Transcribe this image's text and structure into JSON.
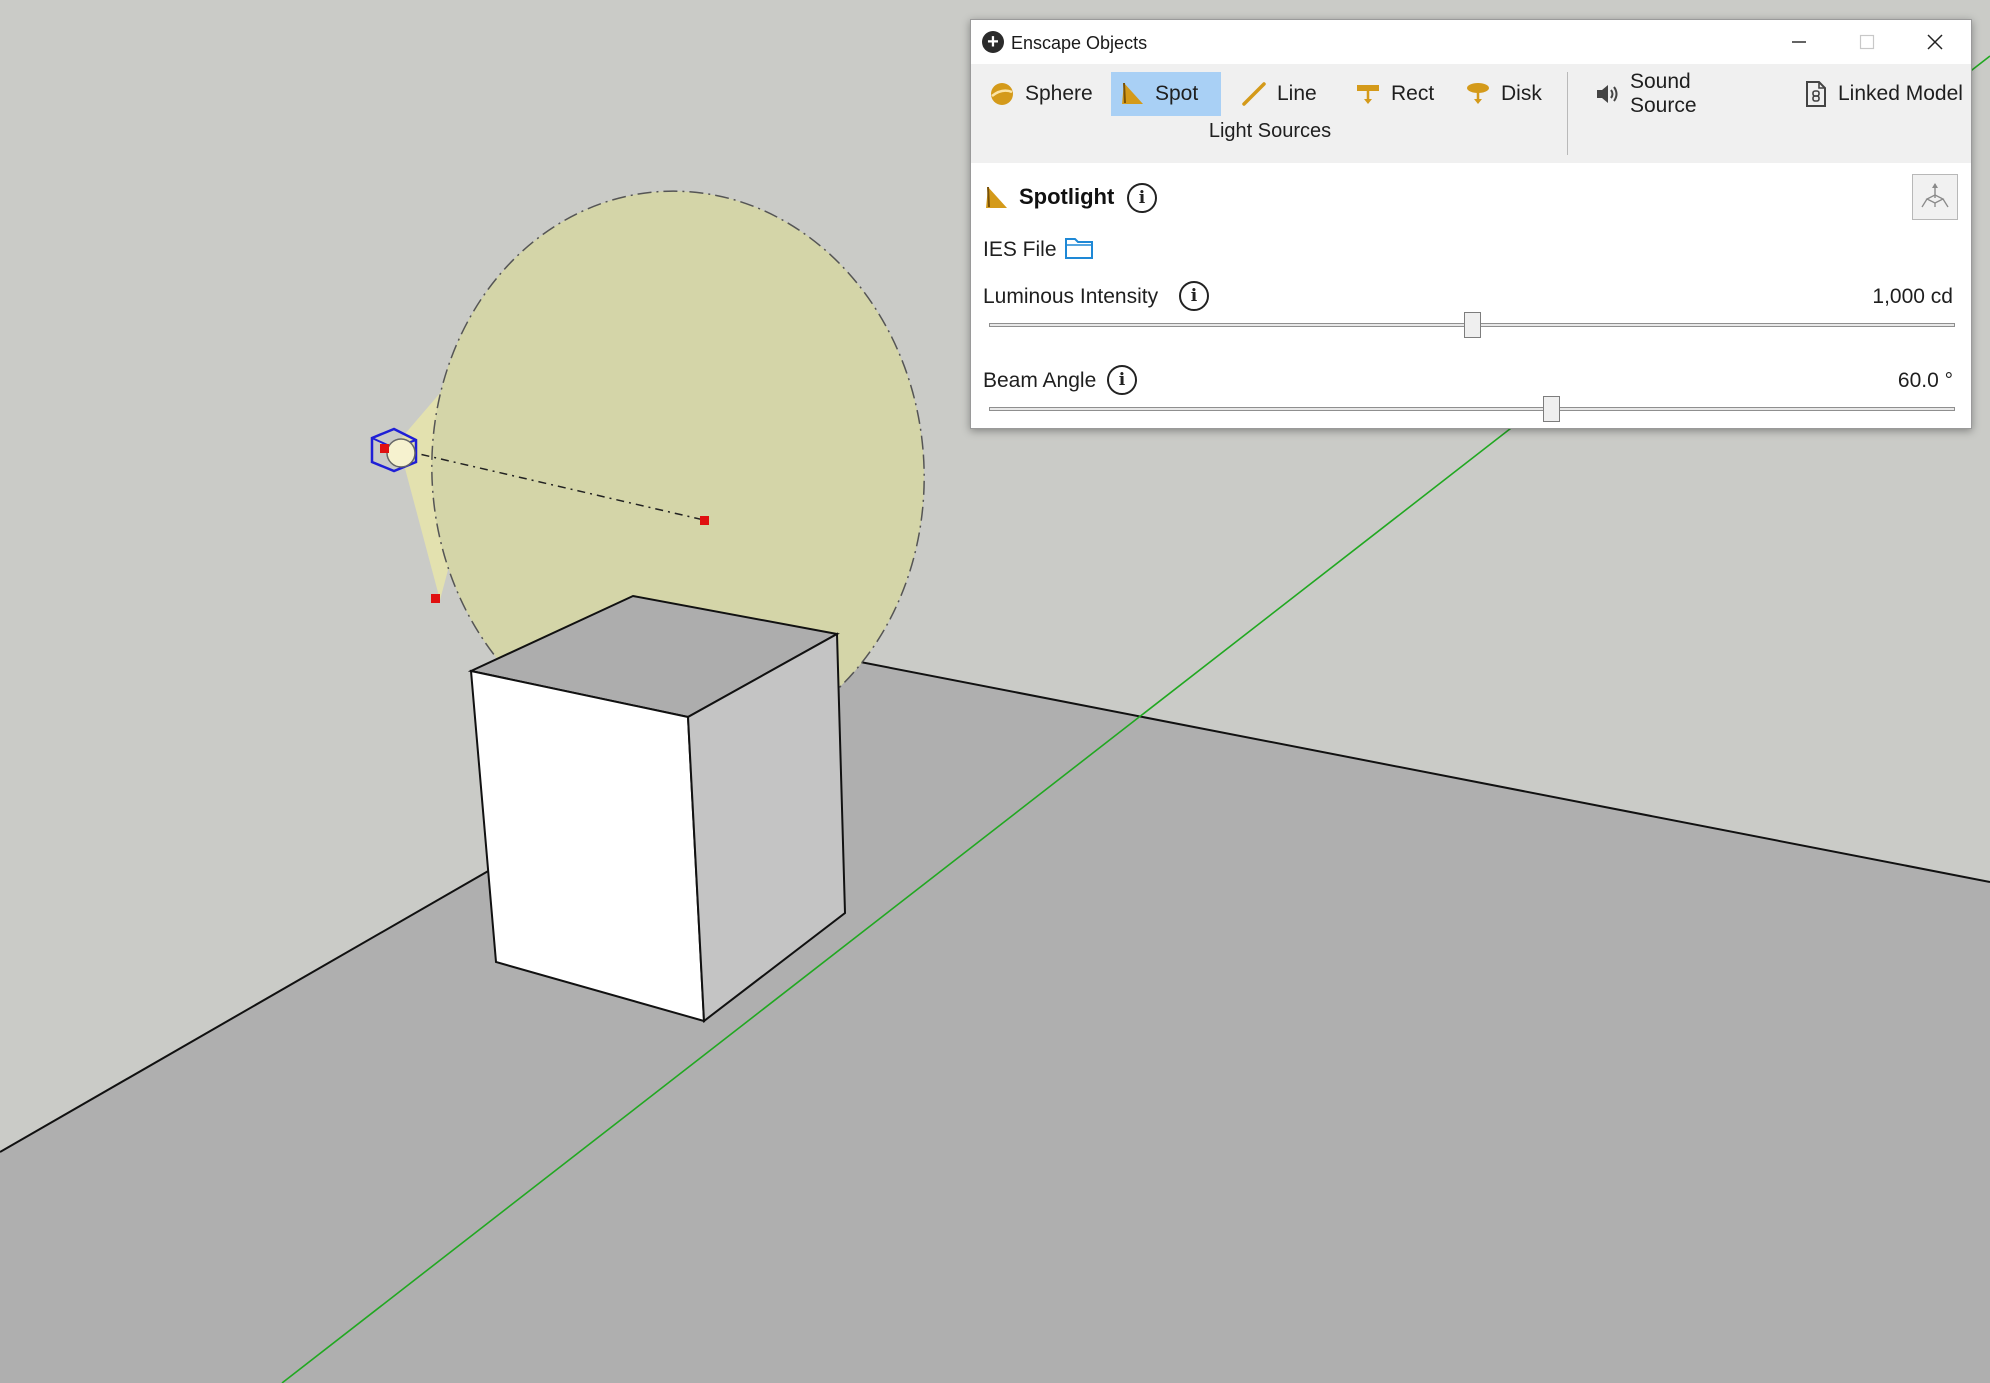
{
  "window": {
    "title": "Enscape Objects",
    "app_icon": "plus-circle-icon"
  },
  "toolbar": {
    "items": [
      {
        "label": "Sphere",
        "icon": "sphere-light-icon",
        "active": false
      },
      {
        "label": "Spot",
        "icon": "spot-light-icon",
        "active": true
      },
      {
        "label": "Line",
        "icon": "line-light-icon",
        "active": false
      },
      {
        "label": "Rect",
        "icon": "rect-light-icon",
        "active": false
      },
      {
        "label": "Disk",
        "icon": "disk-light-icon",
        "active": false
      },
      {
        "label": "Sound Source",
        "icon": "speaker-icon",
        "active": false
      },
      {
        "label": "Linked Model",
        "icon": "linked-model-icon",
        "active": false
      }
    ],
    "group_label": "Light Sources"
  },
  "properties": {
    "heading": "Spotlight",
    "ies_file_label": "IES File",
    "luminous_intensity": {
      "label": "Luminous Intensity",
      "value": "1,000 cd",
      "slider_fraction": 0.5
    },
    "beam_angle": {
      "label": "Beam Angle",
      "value": "60.0 °",
      "slider_fraction": 0.582
    }
  },
  "colors": {
    "accent_active": "#a9d0f5",
    "light_icon": "#d49a1a",
    "folder_icon": "#1e88d6",
    "viewport_background": "#cacbc7",
    "ground": "#afafaf",
    "light_cone": "#d4d5a8",
    "selection": "#1f1fd6",
    "green_axis": "#21a821",
    "control_points": "#e01010"
  }
}
